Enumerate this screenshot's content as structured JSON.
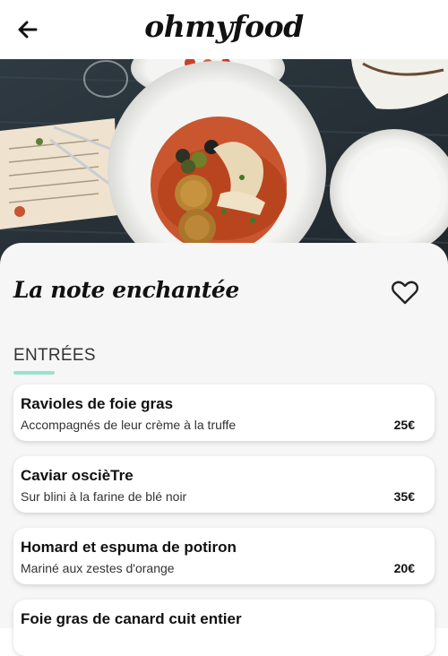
{
  "header": {
    "logo_text": "ohmyfood",
    "back_icon": "arrow-left-icon"
  },
  "hero": {
    "image": "restaurant-dish-photo"
  },
  "restaurant": {
    "name": "La note enchantée",
    "favorite_icon": "heart-outline-icon"
  },
  "menu": {
    "section_title": "ENTRÉES",
    "dishes": [
      {
        "name": "Ravioles de foie gras",
        "description": "Accompagnés de leur crème à la truffe",
        "price": "25€"
      },
      {
        "name": "Caviar oscièTre",
        "description": "Sur blini à la farine de blé noir",
        "price": "35€"
      },
      {
        "name": "Homard et espuma de potiron",
        "description": "Mariné aux zestes d'orange",
        "price": "20€"
      },
      {
        "name": "Foie gras de canard cuit entier",
        "description": "",
        "price": ""
      }
    ]
  },
  "colors": {
    "accent": "#99e2cd",
    "card_background": "#f6f6f6"
  }
}
